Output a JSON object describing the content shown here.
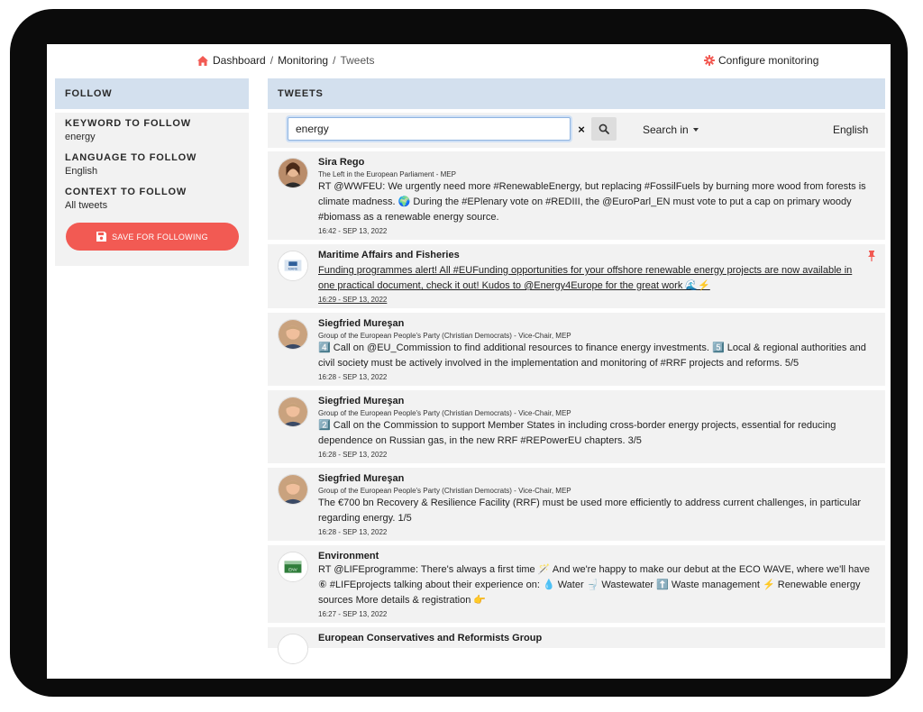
{
  "breadcrumb": {
    "home": "Dashboard",
    "section": "Monitoring",
    "current": "Tweets",
    "separator": "/"
  },
  "configure_label": "Configure monitoring",
  "follow": {
    "header": "FOLLOW",
    "keyword_label": "KEYWORD TO FOLLOW",
    "keyword_value": "energy",
    "language_label": "LANGUAGE TO FOLLOW",
    "language_value": "English",
    "context_label": "CONTEXT TO FOLLOW",
    "context_value": "All tweets",
    "save_label": "SAVE FOR FOLLOWING"
  },
  "tweets_panel": {
    "header": "TWEETS",
    "search_value": "energy",
    "clear_symbol": "×",
    "search_in_label": "Search in",
    "language": "English"
  },
  "tweets": [
    {
      "name": "Sira Rego",
      "affiliation": "The Left in the European Parliament - MEP",
      "text": "RT @WWFEU: We urgently need more #RenewableEnergy, but replacing #FossilFuels by burning more wood from forests is climate madness. 🌍 During the #EPlenary vote on #REDIII, the @EuroParl_EN must vote to put a cap on primary woody #biomass as a renewable energy source.",
      "time": "16:42 - SEP 13, 2022"
    },
    {
      "name": "Maritime Affairs and Fisheries",
      "affiliation": "",
      "text": "Funding programmes alert! All #EUFunding opportunities for your offshore renewable energy projects are now available in one practical document, check it out! Kudos to @Energy4Europe for the great work 🌊⚡",
      "time": "16:29 - SEP 13, 2022",
      "avatar_label": "MARE"
    },
    {
      "name": "Siegfried Mureşan",
      "affiliation": "Group of the European People's Party (Christian Democrats) - Vice-Chair, MEP",
      "text": "4️⃣ Call on @EU_Commission to find additional resources to finance energy investments. 5️⃣ Local & regional authorities and civil society must be actively involved in the implementation and monitoring of #RRF projects and reforms. 5/5",
      "time": "16:28 - SEP 13, 2022"
    },
    {
      "name": "Siegfried Mureşan",
      "affiliation": "Group of the European People's Party (Christian Democrats) - Vice-Chair, MEP",
      "text": "2️⃣ Call on the Commission to support Member States in including cross-border energy projects, essential for reducing dependence on Russian gas, in the new RRF #REPowerEU chapters. 3/5",
      "time": "16:28 - SEP 13, 2022"
    },
    {
      "name": "Siegfried Mureşan",
      "affiliation": "Group of the European People's Party (Christian Democrats) - Vice-Chair, MEP",
      "text": "The €700 bn Recovery & Resilience Facility (RRF) must be used more efficiently to address current challenges, in particular regarding energy. 1/5",
      "time": "16:28 - SEP 13, 2022"
    },
    {
      "name": "Environment",
      "affiliation": "",
      "text": "RT @LIFEprogramme: There's always a first time 🪄 And we're happy to make our debut at the ECO WAVE, where we'll have ⑥ #LIFEprojects talking about their experience on: 💧 Water 🚽 Wastewater ⬆️ Waste management ⚡ Renewable energy sources More details & registration 👉",
      "time": "16:27 - SEP 13, 2022",
      "avatar_label": "ENV"
    },
    {
      "name": "European Conservatives and Reformists Group",
      "affiliation": "",
      "text": "",
      "time": ""
    }
  ],
  "colors": {
    "accent_red": "#f25a53",
    "header_blue": "#d3e0ee",
    "card_grey": "#f2f2f2"
  },
  "icons": [
    "home-icon",
    "gear-icon",
    "save-icon",
    "search-icon",
    "close-icon",
    "caret-down-icon",
    "pin-icon"
  ]
}
